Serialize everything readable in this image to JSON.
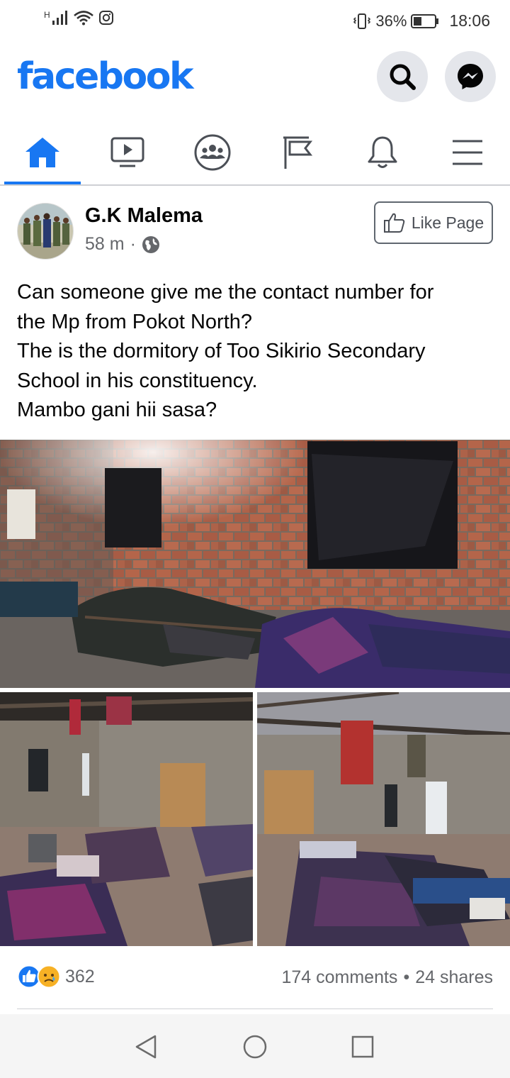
{
  "status_bar": {
    "battery_percent": "36%",
    "time": "18:06",
    "network_letter": "H"
  },
  "header": {
    "logo_text": "facebook",
    "brand_color": "#1877f2"
  },
  "nav_tabs": [
    {
      "name": "home",
      "icon": "home-icon",
      "active": true
    },
    {
      "name": "watch",
      "icon": "video-icon",
      "active": false
    },
    {
      "name": "groups",
      "icon": "groups-icon",
      "active": false
    },
    {
      "name": "pages",
      "icon": "flag-icon",
      "active": false
    },
    {
      "name": "notifications",
      "icon": "bell-icon",
      "active": false
    },
    {
      "name": "menu",
      "icon": "menu-icon",
      "active": false
    }
  ],
  "post": {
    "author": "G.K Malema",
    "time_ago": "58 m",
    "separator": "·",
    "like_page_label": "Like Page",
    "text_lines": [
      "Can someone give me the contact number for",
      "the Mp from Pokot North?",
      "The is the dormitory of Too Sikirio Secondary",
      "School in his constituency.",
      "Mambo gani hii sasa?"
    ],
    "reaction_count": "362",
    "comments": "174 comments",
    "shares": "24 shares",
    "stats_separator": "•"
  }
}
